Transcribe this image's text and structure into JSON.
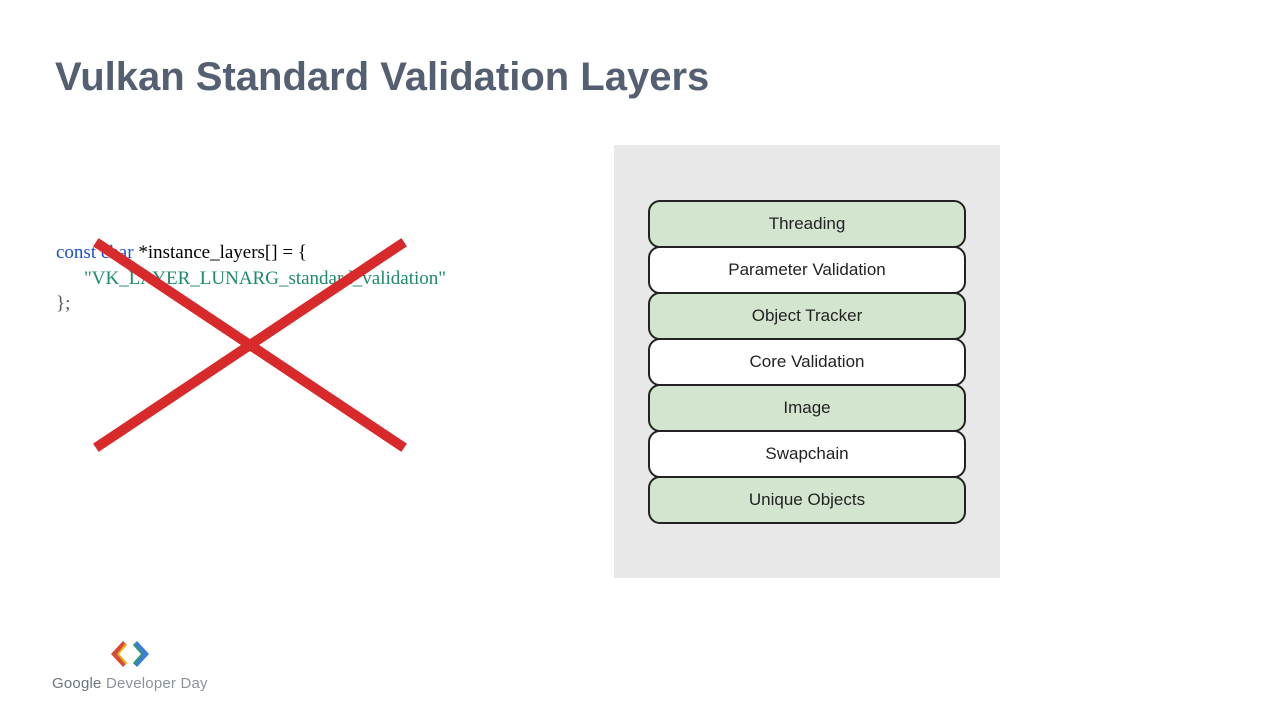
{
  "title": "Vulkan Standard Validation Layers",
  "code": {
    "decl_kw": "const char",
    "decl_rest": " *instance_layers[] = {",
    "layer_string": "\"VK_LAYER_LUNARG_standard_validation\"",
    "close": "};"
  },
  "layers": [
    {
      "label": "Threading",
      "style": "green"
    },
    {
      "label": "Parameter Validation",
      "style": "white"
    },
    {
      "label": "Object Tracker",
      "style": "green"
    },
    {
      "label": "Core Validation",
      "style": "white"
    },
    {
      "label": "Image",
      "style": "green"
    },
    {
      "label": "Swapchain",
      "style": "white"
    },
    {
      "label": "Unique Objects",
      "style": "green"
    }
  ],
  "footer": {
    "brand": "Google",
    "event": " Developer Day"
  },
  "colors": {
    "cross": "#d82a2a",
    "layer_green": "#d4e5cf",
    "panel_bg": "#e8e8e8"
  }
}
